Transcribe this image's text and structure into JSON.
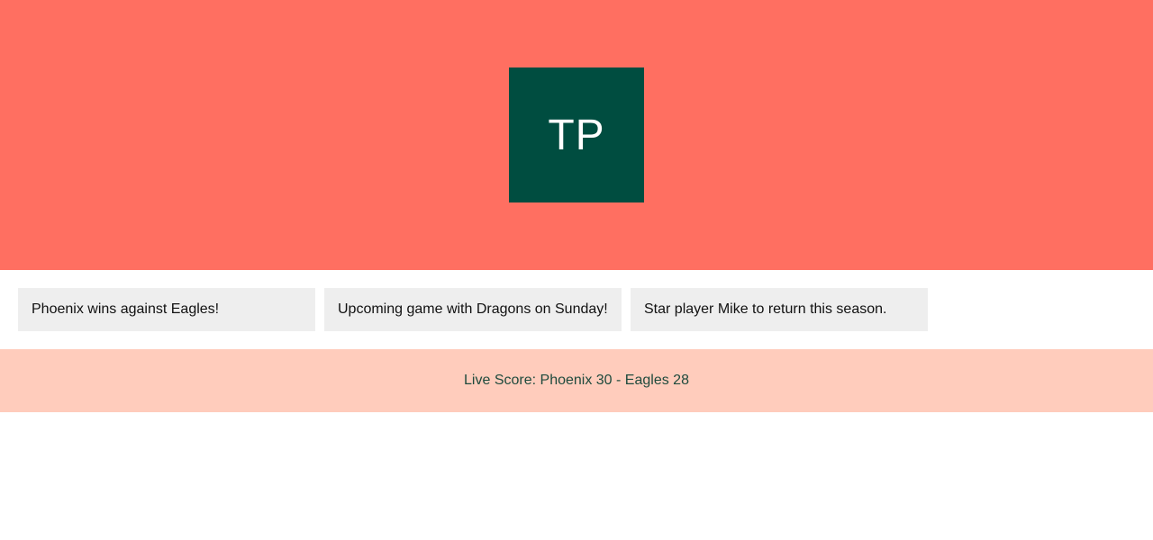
{
  "hero": {
    "logo_text": "TP",
    "background": "#ff6f61",
    "logo_background": "#004d40"
  },
  "news": {
    "items": [
      {
        "text": "Phoenix wins against Eagles!"
      },
      {
        "text": "Upcoming game with Dragons on Sunday!"
      },
      {
        "text": "Star player Mike to return this season."
      }
    ],
    "card_background": "#eeeeee"
  },
  "score": {
    "text": "Live Score: Phoenix 30 - Eagles 28",
    "background": "#ffccbc"
  }
}
